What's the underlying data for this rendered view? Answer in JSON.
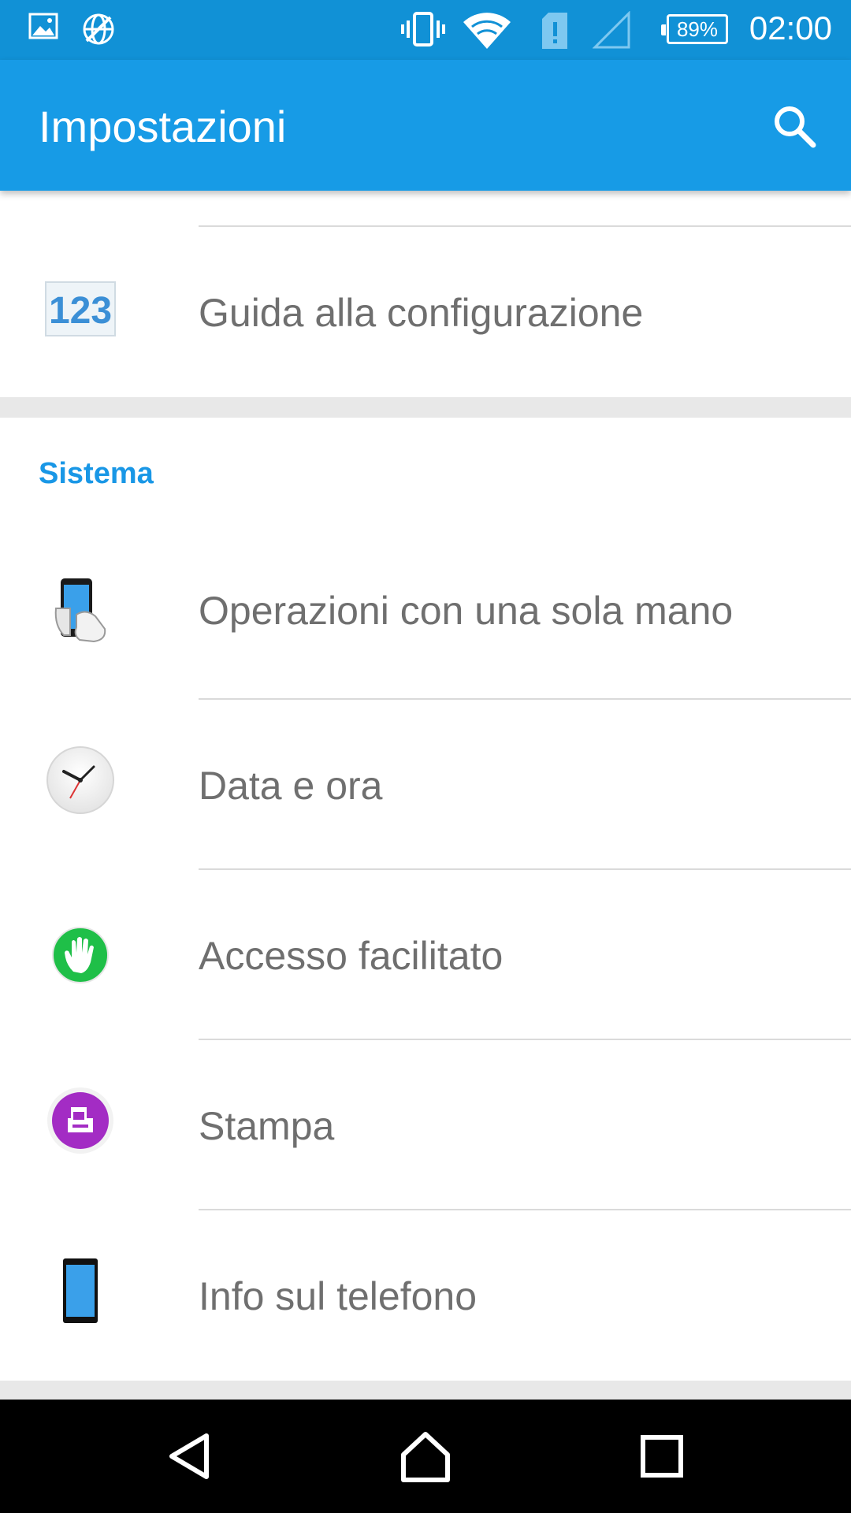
{
  "status_bar": {
    "time": "02:00",
    "battery": "89%",
    "icons": [
      "image-icon",
      "globe-off-icon",
      "vibrate-icon",
      "wifi-icon",
      "sim-alert-icon",
      "signal-icon"
    ]
  },
  "app_bar": {
    "title": "Impostazioni",
    "search_icon": "search-icon"
  },
  "top_items": [
    {
      "label": "Guida alla configurazione",
      "icon": "setup-guide-icon"
    }
  ],
  "section": {
    "title": "Sistema",
    "items": [
      {
        "label": "Operazioni con una sola mano",
        "icon": "one-hand-icon"
      },
      {
        "label": "Data e ora",
        "icon": "clock-icon"
      },
      {
        "label": "Accesso facilitato",
        "icon": "accessibility-hand-icon"
      },
      {
        "label": "Stampa",
        "icon": "print-icon"
      },
      {
        "label": "Info sul telefono",
        "icon": "phone-icon"
      }
    ]
  },
  "nav_bar": {
    "back": "back-icon",
    "home": "home-icon",
    "recents": "recents-icon"
  },
  "colors": {
    "status_bar": "#1191d6",
    "app_bar": "#179be6",
    "accent": "#1997e6"
  }
}
